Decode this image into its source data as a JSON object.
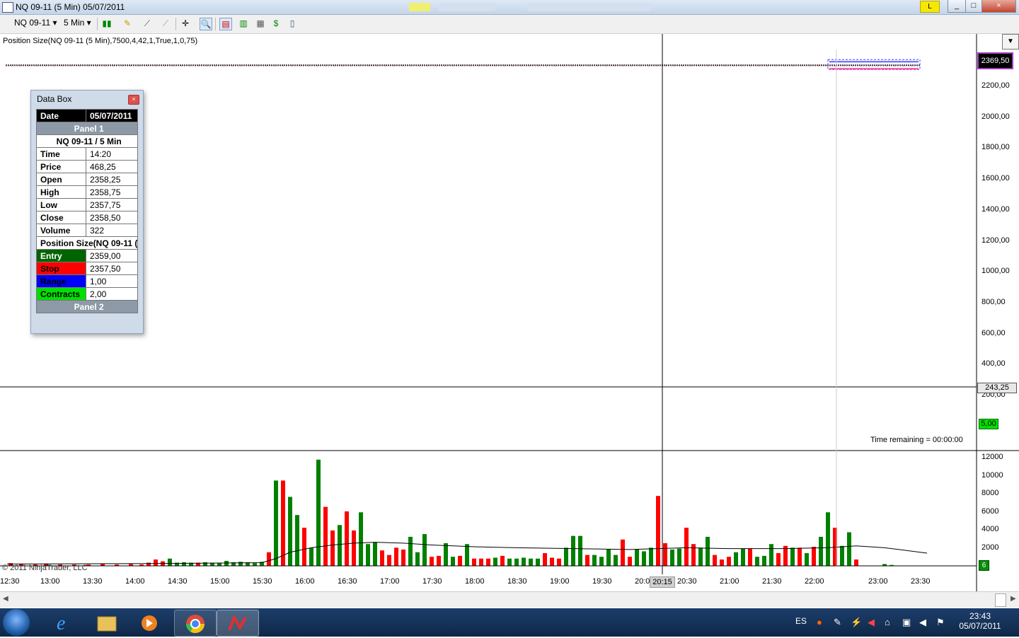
{
  "window": {
    "title": "NQ 09-11 (5 Min)  05/07/2011",
    "badge": "L",
    "controls": [
      "_",
      "□",
      "×"
    ]
  },
  "toolbar": {
    "instrument": "NQ 09-11",
    "interval": "5 Min"
  },
  "indicator_label": "Position Size(NQ 09-11 (5 Min),7500,4,42,1,True,1,0,75)",
  "data_box": {
    "title": "Data Box",
    "date_label": "Date",
    "date_value": "05/07/2011",
    "panel1": "Panel 1",
    "series_header": "NQ 09-11 / 5 Min",
    "rows": [
      {
        "label": "Time",
        "value": "14:20"
      },
      {
        "label": "Price",
        "value": "468,25"
      },
      {
        "label": "Open",
        "value": "2358,25"
      },
      {
        "label": "High",
        "value": "2358,75"
      },
      {
        "label": "Low",
        "value": "2357,75"
      },
      {
        "label": "Close",
        "value": "2358,50"
      },
      {
        "label": "Volume",
        "value": "322"
      }
    ],
    "indicator_header": "Position Size(NQ 09-11 (",
    "indicator_rows": [
      {
        "label": "Entry",
        "value": "2359,00",
        "color": "#006400"
      },
      {
        "label": "Stop",
        "value": "2357,50",
        "color": "#ff0000"
      },
      {
        "label": "Range",
        "value": "1,00",
        "color": "#0000ff"
      },
      {
        "label": "Contracts",
        "value": "2,00",
        "color": "#00e000"
      }
    ],
    "panel2": "Panel 2"
  },
  "price_axis": {
    "last_price": "2369,50",
    "cursor_price": "243,25",
    "indicator_value": "5,00",
    "ticks": [
      "2200,00",
      "2000,00",
      "1800,00",
      "1600,00",
      "1400,00",
      "1200,00",
      "1000,00",
      "800,00",
      "600,00",
      "400,00",
      "200,00"
    ]
  },
  "volume_axis": {
    "ticks": [
      "12000",
      "10000",
      "8000",
      "6000",
      "4000",
      "2000"
    ],
    "zero_label": "6"
  },
  "time_remaining": "Time remaining = 00:00:00",
  "copyright": "© 2011 NinjaTrader, LLC",
  "cursor_time": "20:15",
  "chart_data": {
    "type": "bar",
    "title": "",
    "xlabel": "",
    "ylabel": "",
    "x_ticks": [
      "12:30",
      "13:00",
      "13:30",
      "14:00",
      "14:30",
      "15:00",
      "15:30",
      "16:00",
      "16:30",
      "17:00",
      "17:30",
      "18:00",
      "18:30",
      "19:00",
      "19:30",
      "20:00",
      "20:30",
      "21:00",
      "21:30",
      "22:00",
      "23:00",
      "23:30"
    ],
    "volume_ylim": [
      0,
      12000
    ],
    "volume_bars": [
      {
        "t": 0.5,
        "v": 300,
        "c": "red"
      },
      {
        "t": 2,
        "v": 200,
        "c": "red"
      },
      {
        "t": 4,
        "v": 150,
        "c": "red"
      },
      {
        "t": 5.5,
        "v": 250,
        "c": "red"
      },
      {
        "t": 7.5,
        "v": 150,
        "c": "red"
      },
      {
        "t": 9.5,
        "v": 150,
        "c": "red"
      },
      {
        "t": 11.5,
        "v": 150,
        "c": "red"
      },
      {
        "t": 13.5,
        "v": 200,
        "c": "red"
      },
      {
        "t": 15.5,
        "v": 150,
        "c": "red"
      },
      {
        "t": 17.5,
        "v": 200,
        "c": "red"
      },
      {
        "t": 19,
        "v": 150,
        "c": "red"
      },
      {
        "t": 20,
        "v": 350,
        "c": "red"
      },
      {
        "t": 21,
        "v": 700,
        "c": "red"
      },
      {
        "t": 22,
        "v": 500,
        "c": "red"
      },
      {
        "t": 23,
        "v": 800,
        "c": "green"
      },
      {
        "t": 24,
        "v": 350,
        "c": "green"
      },
      {
        "t": 25,
        "v": 400,
        "c": "green"
      },
      {
        "t": 26,
        "v": 350,
        "c": "green"
      },
      {
        "t": 27,
        "v": 350,
        "c": "red"
      },
      {
        "t": 28,
        "v": 400,
        "c": "green"
      },
      {
        "t": 29,
        "v": 350,
        "c": "green"
      },
      {
        "t": 30,
        "v": 350,
        "c": "green"
      },
      {
        "t": 31,
        "v": 550,
        "c": "green"
      },
      {
        "t": 32,
        "v": 400,
        "c": "green"
      },
      {
        "t": 33,
        "v": 450,
        "c": "green"
      },
      {
        "t": 34,
        "v": 400,
        "c": "green"
      },
      {
        "t": 35,
        "v": 300,
        "c": "green"
      },
      {
        "t": 36,
        "v": 450,
        "c": "green"
      },
      {
        "t": 37,
        "v": 1500,
        "c": "red"
      },
      {
        "t": 38,
        "v": 9400,
        "c": "green"
      },
      {
        "t": 39,
        "v": 9400,
        "c": "red"
      },
      {
        "t": 40,
        "v": 7600,
        "c": "green"
      },
      {
        "t": 41,
        "v": 5600,
        "c": "green"
      },
      {
        "t": 42,
        "v": 4200,
        "c": "red"
      },
      {
        "t": 43,
        "v": 2000,
        "c": "green"
      },
      {
        "t": 44,
        "v": 11700,
        "c": "green"
      },
      {
        "t": 45,
        "v": 6500,
        "c": "red"
      },
      {
        "t": 46,
        "v": 3900,
        "c": "red"
      },
      {
        "t": 47,
        "v": 4500,
        "c": "green"
      },
      {
        "t": 48,
        "v": 6000,
        "c": "red"
      },
      {
        "t": 49,
        "v": 3900,
        "c": "red"
      },
      {
        "t": 50,
        "v": 5900,
        "c": "green"
      },
      {
        "t": 51,
        "v": 2400,
        "c": "green"
      },
      {
        "t": 52,
        "v": 2600,
        "c": "green"
      },
      {
        "t": 53,
        "v": 1700,
        "c": "red"
      },
      {
        "t": 54,
        "v": 1200,
        "c": "red"
      },
      {
        "t": 55,
        "v": 2000,
        "c": "red"
      },
      {
        "t": 56,
        "v": 1800,
        "c": "red"
      },
      {
        "t": 57,
        "v": 3200,
        "c": "green"
      },
      {
        "t": 58,
        "v": 1500,
        "c": "green"
      },
      {
        "t": 59,
        "v": 3500,
        "c": "green"
      },
      {
        "t": 60,
        "v": 1000,
        "c": "red"
      },
      {
        "t": 61,
        "v": 1100,
        "c": "red"
      },
      {
        "t": 62,
        "v": 2500,
        "c": "green"
      },
      {
        "t": 63,
        "v": 1000,
        "c": "green"
      },
      {
        "t": 64,
        "v": 1100,
        "c": "red"
      },
      {
        "t": 65,
        "v": 2400,
        "c": "green"
      },
      {
        "t": 66,
        "v": 800,
        "c": "red"
      },
      {
        "t": 67,
        "v": 800,
        "c": "red"
      },
      {
        "t": 68,
        "v": 800,
        "c": "red"
      },
      {
        "t": 69,
        "v": 900,
        "c": "green"
      },
      {
        "t": 70,
        "v": 1100,
        "c": "red"
      },
      {
        "t": 71,
        "v": 800,
        "c": "green"
      },
      {
        "t": 72,
        "v": 800,
        "c": "green"
      },
      {
        "t": 73,
        "v": 900,
        "c": "green"
      },
      {
        "t": 74,
        "v": 800,
        "c": "green"
      },
      {
        "t": 75,
        "v": 800,
        "c": "green"
      },
      {
        "t": 76,
        "v": 1400,
        "c": "red"
      },
      {
        "t": 77,
        "v": 900,
        "c": "red"
      },
      {
        "t": 78,
        "v": 800,
        "c": "red"
      },
      {
        "t": 79,
        "v": 2000,
        "c": "green"
      },
      {
        "t": 80,
        "v": 3300,
        "c": "green"
      },
      {
        "t": 81,
        "v": 3300,
        "c": "green"
      },
      {
        "t": 82,
        "v": 1200,
        "c": "red"
      },
      {
        "t": 83,
        "v": 1200,
        "c": "green"
      },
      {
        "t": 84,
        "v": 1000,
        "c": "green"
      },
      {
        "t": 85,
        "v": 1800,
        "c": "green"
      },
      {
        "t": 86,
        "v": 1200,
        "c": "green"
      },
      {
        "t": 87,
        "v": 2900,
        "c": "red"
      },
      {
        "t": 88,
        "v": 1000,
        "c": "red"
      },
      {
        "t": 89,
        "v": 1800,
        "c": "green"
      },
      {
        "t": 90,
        "v": 1600,
        "c": "green"
      },
      {
        "t": 91,
        "v": 2000,
        "c": "green"
      },
      {
        "t": 92,
        "v": 7700,
        "c": "red"
      },
      {
        "t": 93,
        "v": 2500,
        "c": "red"
      },
      {
        "t": 94,
        "v": 1800,
        "c": "green"
      },
      {
        "t": 95,
        "v": 1900,
        "c": "green"
      },
      {
        "t": 96,
        "v": 4200,
        "c": "red"
      },
      {
        "t": 97,
        "v": 2400,
        "c": "red"
      },
      {
        "t": 98,
        "v": 2000,
        "c": "green"
      },
      {
        "t": 99,
        "v": 3200,
        "c": "green"
      },
      {
        "t": 100,
        "v": 1200,
        "c": "red"
      },
      {
        "t": 101,
        "v": 700,
        "c": "red"
      },
      {
        "t": 102,
        "v": 1000,
        "c": "red"
      },
      {
        "t": 103,
        "v": 1500,
        "c": "green"
      },
      {
        "t": 104,
        "v": 1900,
        "c": "green"
      },
      {
        "t": 105,
        "v": 1900,
        "c": "red"
      },
      {
        "t": 106,
        "v": 1000,
        "c": "green"
      },
      {
        "t": 107,
        "v": 1100,
        "c": "green"
      },
      {
        "t": 108,
        "v": 2400,
        "c": "green"
      },
      {
        "t": 109,
        "v": 1400,
        "c": "red"
      },
      {
        "t": 110,
        "v": 2200,
        "c": "red"
      },
      {
        "t": 111,
        "v": 2000,
        "c": "green"
      },
      {
        "t": 112,
        "v": 2000,
        "c": "red"
      },
      {
        "t": 113,
        "v": 1400,
        "c": "green"
      },
      {
        "t": 114,
        "v": 2100,
        "c": "red"
      },
      {
        "t": 115,
        "v": 3200,
        "c": "green"
      },
      {
        "t": 116,
        "v": 5900,
        "c": "green"
      },
      {
        "t": 117,
        "v": 4200,
        "c": "red"
      },
      {
        "t": 118,
        "v": 2200,
        "c": "green"
      },
      {
        "t": 119,
        "v": 3700,
        "c": "green"
      },
      {
        "t": 120,
        "v": 700,
        "c": "red"
      },
      {
        "t": 124,
        "v": 200,
        "c": "green"
      },
      {
        "t": 125,
        "v": 100,
        "c": "green"
      }
    ],
    "volume_ma": [
      [
        0,
        200
      ],
      [
        20,
        250
      ],
      [
        36,
        350
      ],
      [
        38,
        800
      ],
      [
        40,
        1500
      ],
      [
        43,
        2000
      ],
      [
        46,
        2300
      ],
      [
        49,
        2500
      ],
      [
        52,
        2600
      ],
      [
        56,
        2500
      ],
      [
        60,
        2300
      ],
      [
        66,
        2100
      ],
      [
        72,
        2000
      ],
      [
        80,
        1900
      ],
      [
        88,
        1800
      ],
      [
        92,
        1900
      ],
      [
        96,
        2000
      ],
      [
        102,
        1900
      ],
      [
        110,
        1900
      ],
      [
        116,
        2000
      ],
      [
        120,
        2200
      ],
      [
        124,
        2000
      ],
      [
        130,
        1400
      ]
    ],
    "price_ylim": [
      100,
      2400
    ],
    "price_series_level": 2360
  }
}
